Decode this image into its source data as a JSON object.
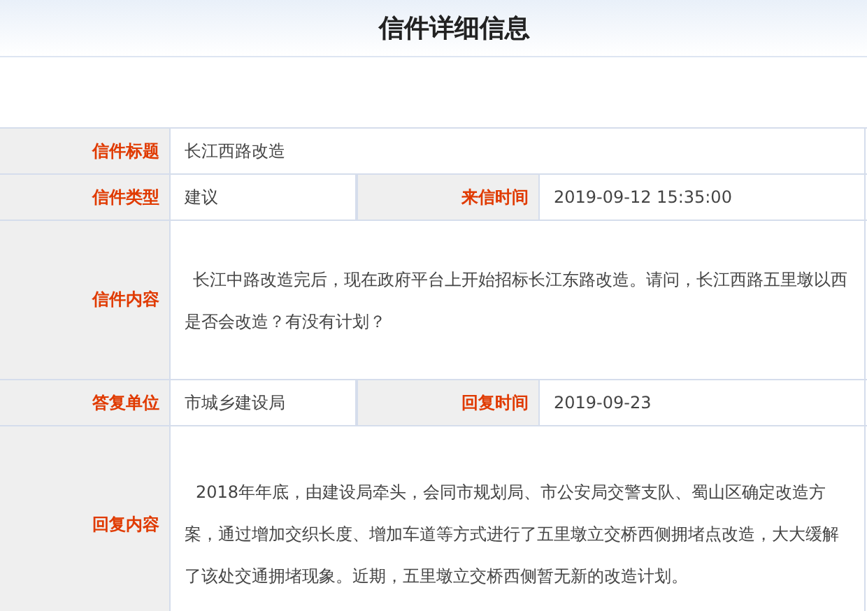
{
  "page_title": "信件详细信息",
  "rows": [
    {
      "cells": [
        {
          "label": "信件标题",
          "value": "长江西路改造"
        }
      ]
    },
    {
      "cells": [
        {
          "label": "信件类型",
          "value": "建议"
        },
        {
          "label": "来信时间",
          "value": "2019-09-12 15:35:00"
        }
      ]
    },
    {
      "kind": "long",
      "cells": [
        {
          "label": "信件内容",
          "value": "长江中路改造完后，现在政府平台上开始招标长江东路改造。请问，长江西路五里墩以西是否会改造？有没有计划？"
        }
      ]
    },
    {
      "cells": [
        {
          "label": "答复单位",
          "value": "市城乡建设局"
        },
        {
          "label": "回复时间",
          "value": "2019-09-23"
        }
      ]
    },
    {
      "kind": "reply",
      "cells": [
        {
          "label": "回复内容",
          "value": "2018年年底，由建设局牵头，会同市规划局、市公安局交警支队、蜀山区确定改造方案，通过增加交织长度、增加车道等方式进行了五里墩立交桥西侧拥堵点改造，大大缓解了该处交通拥堵现象。近期，五里墩立交桥西侧暂无新的改造计划。"
        }
      ]
    }
  ]
}
